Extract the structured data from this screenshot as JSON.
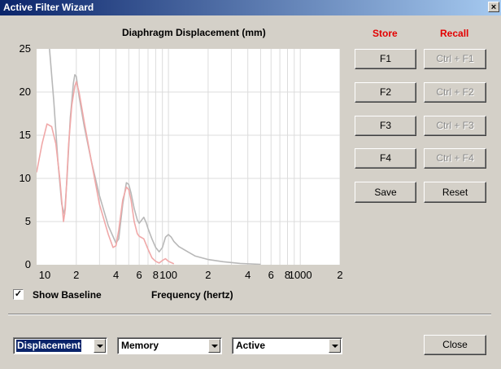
{
  "window": {
    "title": "Active Filter Wizard",
    "close_glyph": "×"
  },
  "chart_data": {
    "type": "line",
    "title": "Diaphragm Displacement (mm)",
    "xlabel": "Frequency (hertz)",
    "ylabel": "",
    "xscale": "log",
    "xlim": [
      10,
      2000
    ],
    "ylim": [
      0,
      25
    ],
    "grid": true,
    "ytick_labels": [
      "25",
      "20",
      "15",
      "10",
      "5",
      "0"
    ],
    "xtick_labels": [
      "10",
      "2",
      "4",
      "6",
      "8",
      "100",
      "2",
      "4",
      "6",
      "8",
      "1000",
      "2"
    ],
    "series": [
      {
        "color": "#b8b8b8",
        "x": [
          12.5,
          13.5,
          14.5,
          15.5,
          16.3,
          17,
          18,
          19,
          19.5,
          20,
          21,
          23,
          26,
          30,
          35,
          40,
          42,
          45,
          48,
          50,
          52,
          55,
          58,
          60,
          65,
          68,
          70,
          75,
          80,
          85,
          90,
          95,
          100,
          105,
          110,
          120,
          140,
          160,
          200,
          260,
          350,
          500
        ],
        "y": [
          25.2,
          19,
          12,
          7,
          5.8,
          10,
          17,
          21,
          22,
          21.8,
          19.5,
          16,
          12,
          8,
          4.5,
          2.5,
          3,
          7,
          9.5,
          9.3,
          8.3,
          6.5,
          5.2,
          4.8,
          5.5,
          4.8,
          4.2,
          3,
          2,
          1.5,
          2,
          3.2,
          3.5,
          3.2,
          2.7,
          2.1,
          1.5,
          1,
          0.6,
          0.35,
          0.15,
          0.05
        ]
      },
      {
        "color": "#f0a8a8",
        "x": [
          10,
          11,
          12,
          13,
          14,
          15,
          16,
          16.5,
          17.5,
          18.5,
          19.5,
          20,
          21,
          23,
          26,
          30,
          35,
          38,
          40,
          42,
          45,
          48,
          50,
          52,
          55,
          58,
          60,
          65,
          70,
          75,
          80,
          85,
          90,
          95,
          100,
          110
        ],
        "y": [
          10.7,
          14,
          16.3,
          16,
          14,
          10,
          5,
          6.5,
          14,
          18.5,
          20.7,
          21.2,
          20,
          16.5,
          12,
          7,
          3.5,
          2,
          2.2,
          4,
          7.5,
          9,
          8.7,
          7.5,
          5,
          3.6,
          3.3,
          3,
          1.8,
          0.8,
          0.4,
          0.2,
          0.5,
          0.7,
          0.4,
          0.1
        ]
      }
    ]
  },
  "store": {
    "header": "Store",
    "buttons": [
      "F1",
      "F2",
      "F3",
      "F4"
    ]
  },
  "recall": {
    "header": "Recall",
    "buttons": [
      "Ctrl + F1",
      "Ctrl + F2",
      "Ctrl + F3",
      "Ctrl + F4"
    ]
  },
  "actions": {
    "save": "Save",
    "reset": "Reset",
    "close": "Close"
  },
  "options": {
    "show_baseline_label": "Show Baseline",
    "show_baseline_checked": true
  },
  "dropdowns": {
    "view": "Displacement",
    "memory": "Memory",
    "active": "Active"
  }
}
